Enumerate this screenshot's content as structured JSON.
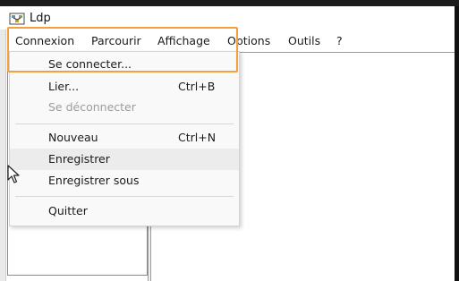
{
  "window": {
    "title": "Ldp"
  },
  "menubar": {
    "items": [
      {
        "label": "Connexion"
      },
      {
        "label": "Parcourir"
      },
      {
        "label": "Affichage"
      },
      {
        "label": "Options"
      },
      {
        "label": "Outils"
      },
      {
        "label": "?"
      }
    ]
  },
  "dropdown": {
    "items": [
      {
        "label": "Se connecter...",
        "shortcut": ""
      },
      {
        "label": "Lier...",
        "shortcut": "Ctrl+B"
      },
      {
        "label": "Se déconnecter",
        "shortcut": ""
      },
      {
        "label": "Nouveau",
        "shortcut": "Ctrl+N"
      },
      {
        "label": "Enregistrer",
        "shortcut": ""
      },
      {
        "label": "Enregistrer sous",
        "shortcut": ""
      },
      {
        "label": "Quitter",
        "shortcut": ""
      }
    ]
  },
  "colors": {
    "highlight_outline": "#f5a03c",
    "disabled_text": "#9c9c9c"
  },
  "icons": {
    "app": "ldp-tree-icon",
    "cursor": "mouse-pointer-icon"
  }
}
